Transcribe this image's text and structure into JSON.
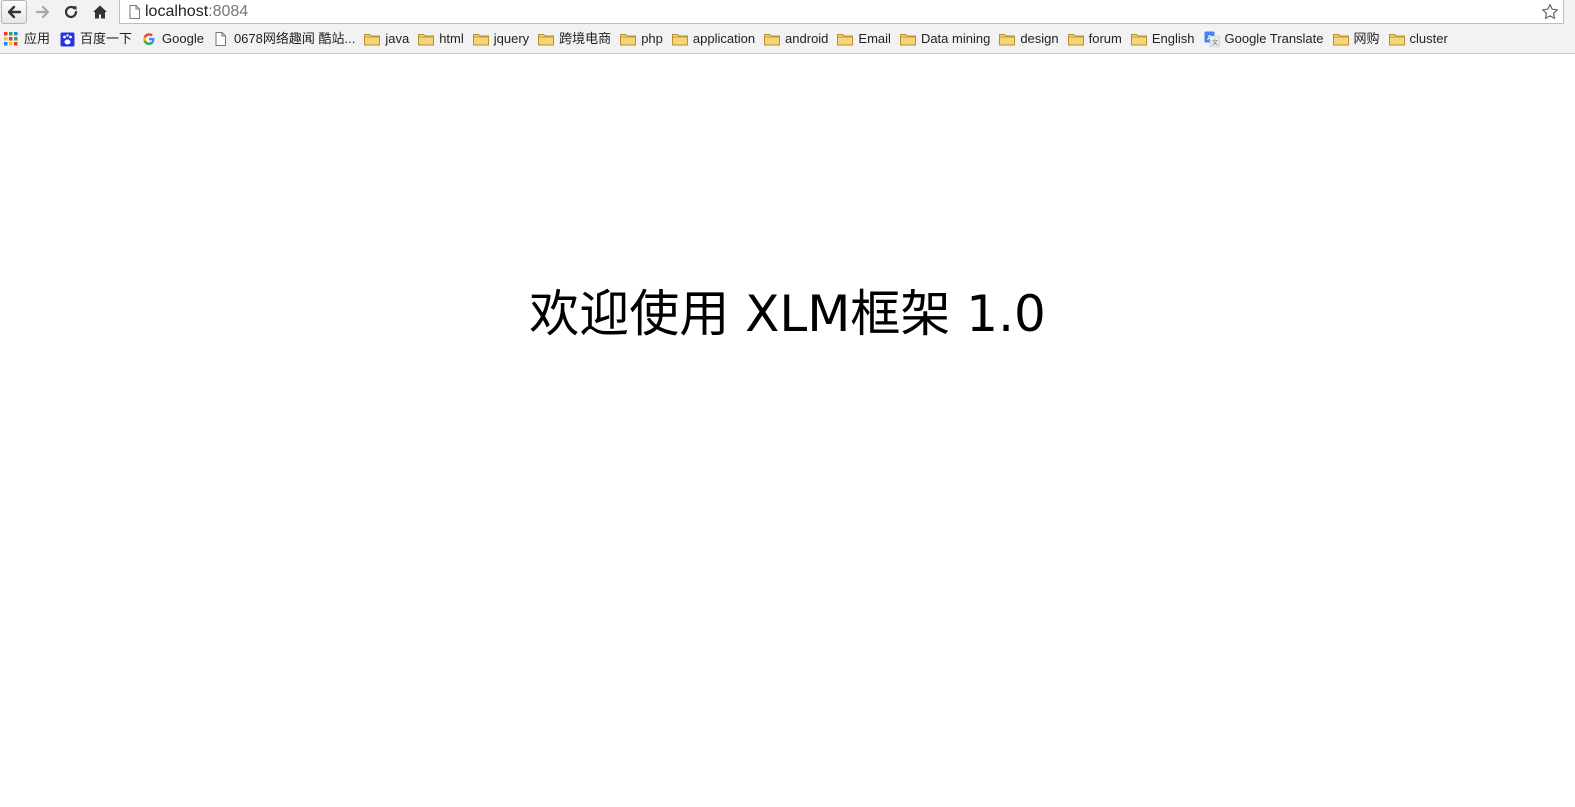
{
  "browser": {
    "address_bar": {
      "host": "localhost",
      "port": ":8084"
    },
    "bookmarks": [
      {
        "label": "应用",
        "icon": "apps-grid-icon"
      },
      {
        "label": "百度一下",
        "icon": "baidu-icon"
      },
      {
        "label": "Google",
        "icon": "google-icon"
      },
      {
        "label": "0678网络趣闻 酷站...",
        "icon": "page-icon"
      },
      {
        "label": "java",
        "icon": "folder-icon"
      },
      {
        "label": "html",
        "icon": "folder-icon"
      },
      {
        "label": "jquery",
        "icon": "folder-icon"
      },
      {
        "label": "跨境电商",
        "icon": "folder-icon"
      },
      {
        "label": "php",
        "icon": "folder-icon"
      },
      {
        "label": "application",
        "icon": "folder-icon"
      },
      {
        "label": "android",
        "icon": "folder-icon"
      },
      {
        "label": "Email",
        "icon": "folder-icon"
      },
      {
        "label": "Data mining",
        "icon": "folder-icon"
      },
      {
        "label": "design",
        "icon": "folder-icon"
      },
      {
        "label": "forum",
        "icon": "folder-icon"
      },
      {
        "label": "English",
        "icon": "folder-icon"
      },
      {
        "label": "Google Translate",
        "icon": "google-translate-icon"
      },
      {
        "label": "网购",
        "icon": "folder-icon"
      },
      {
        "label": "cluster",
        "icon": "folder-icon"
      }
    ]
  },
  "page": {
    "heading": "欢迎使用 XLM框架 1.0"
  },
  "colors": {
    "folder_fill": "#f5d57a",
    "folder_stroke": "#b8902e",
    "text": "#000000"
  }
}
